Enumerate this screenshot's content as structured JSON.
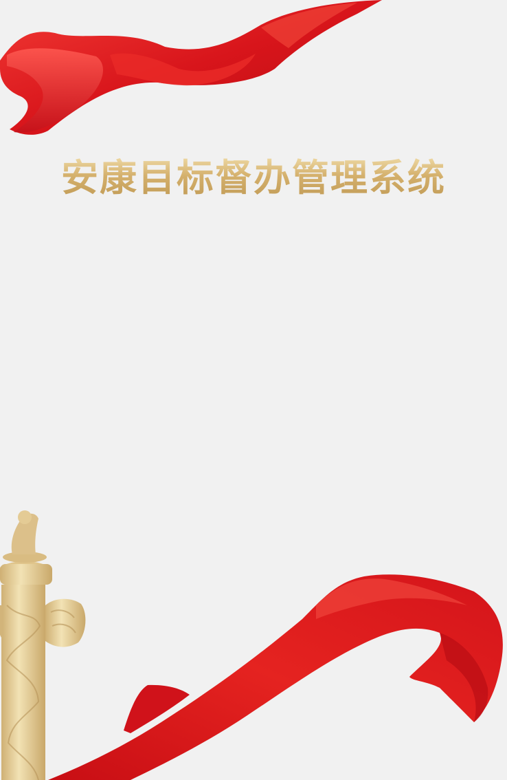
{
  "app": {
    "title": "安康目标督办管理系统"
  },
  "decorations": {
    "top_ribbon": "red-silk-ribbon",
    "bottom_ribbon": "red-silk-ribbon",
    "pillar": "huabiao-pillar"
  },
  "colors": {
    "background": "#f1f1f1",
    "ribbon_red": "#e3191e",
    "title_gold": "#d4b06c",
    "pillar_gold": "#e6cf98"
  }
}
